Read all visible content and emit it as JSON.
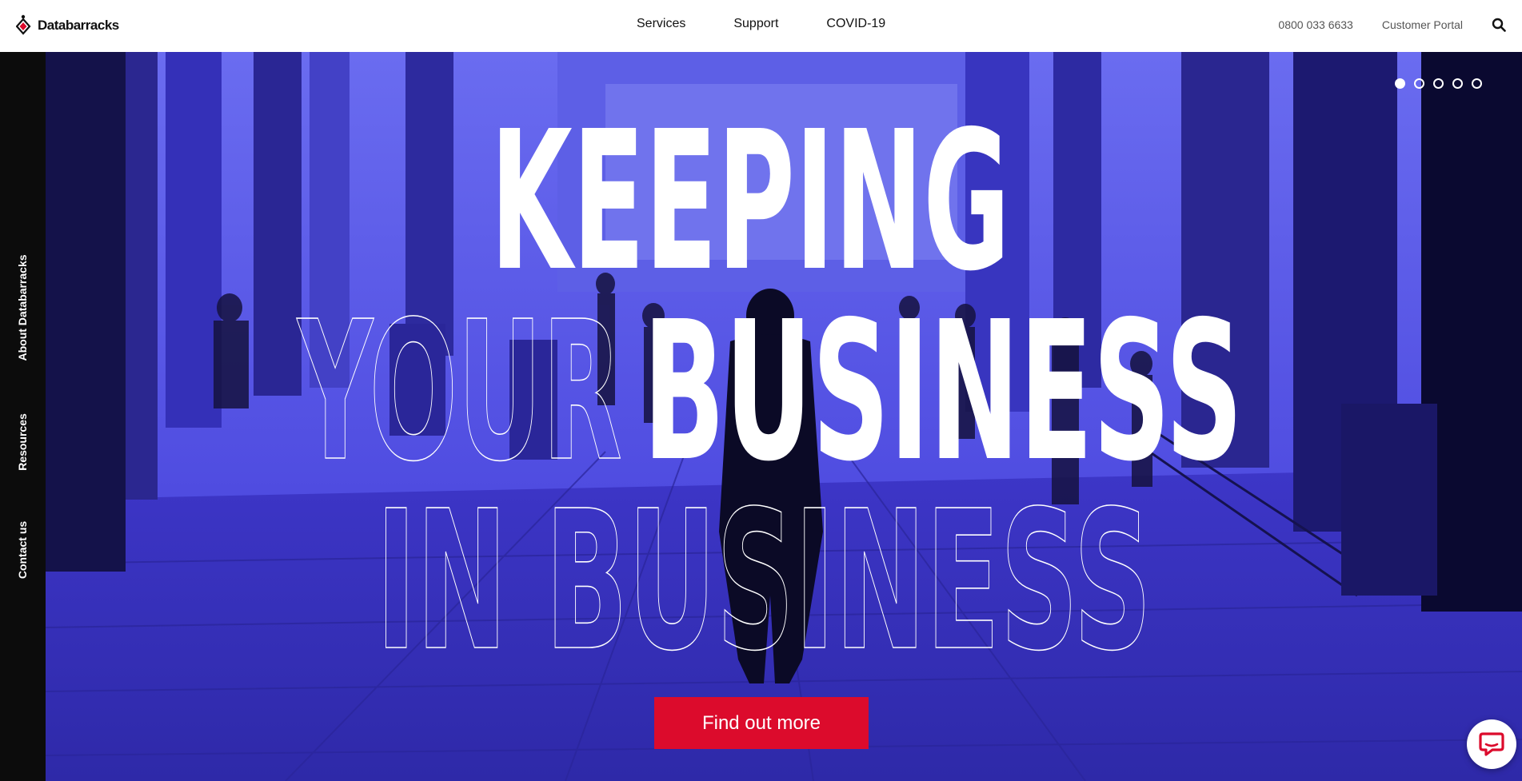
{
  "brand": {
    "name": "Databarracks",
    "accent": "#dc0b2c",
    "hero_tint": "#3b35d4"
  },
  "header": {
    "nav": [
      {
        "label": "Services"
      },
      {
        "label": "Support"
      },
      {
        "label": "COVID-19"
      }
    ],
    "phone": "0800 033 6633",
    "customer_portal": "Customer Portal",
    "search_icon": "search-icon"
  },
  "side_nav": [
    {
      "label": "About Databarracks"
    },
    {
      "label": "Resources"
    },
    {
      "label": "Contact us"
    }
  ],
  "hero": {
    "line1": "KEEPING",
    "line2_outline": "YOUR",
    "line2_solid": "BUSINESS",
    "line3_outline": "IN BUSINESS",
    "cta_label": "Find out more",
    "slides_total": 5,
    "active_slide": 1
  },
  "chat": {
    "icon": "chat-bubble-icon"
  }
}
